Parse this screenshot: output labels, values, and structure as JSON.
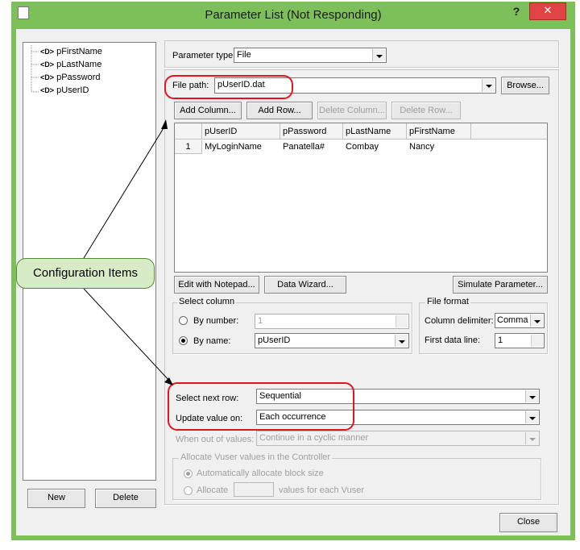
{
  "window": {
    "title": "Parameter List (Not Responding)",
    "help_glyph": "?",
    "close_glyph": "✕"
  },
  "tree": {
    "items": [
      "pFirstName",
      "pLastName",
      "pPassword",
      "pUserID"
    ],
    "icon_text": "<D>"
  },
  "left_buttons": {
    "new": "New",
    "delete": "Delete"
  },
  "param_type": {
    "label": "Parameter type:",
    "value": "File"
  },
  "file_path": {
    "label": "File path:",
    "value": "pUserID.dat",
    "browse": "Browse..."
  },
  "table_buttons": {
    "add_column": "Add Column...",
    "add_row": "Add Row...",
    "delete_column": "Delete Column...",
    "delete_row": "Delete Row..."
  },
  "table": {
    "headers": [
      "pUserID",
      "pPassword",
      "pLastName",
      "pFirstName"
    ],
    "rows": [
      {
        "num": "1",
        "cells": [
          "MyLoginName",
          "Panatella#",
          "Combay",
          "Nancy"
        ]
      }
    ]
  },
  "actions": {
    "edit_notepad": "Edit with Notepad...",
    "data_wizard": "Data Wizard...",
    "simulate": "Simulate Parameter..."
  },
  "select_column": {
    "title": "Select column",
    "by_number_label": "By number:",
    "by_number_value": "1",
    "by_name_label": "By name:",
    "by_name_value": "pUserID"
  },
  "file_format": {
    "title": "File format",
    "delimiter_label": "Column delimiter:",
    "delimiter_value": "Comma",
    "first_line_label": "First data line:",
    "first_line_value": "1"
  },
  "row_options": {
    "next_row_label": "Select next row:",
    "next_row_value": "Sequential",
    "update_label": "Update value on:",
    "update_value": "Each occurrence",
    "out_label": "When out of values:",
    "out_value": "Continue in a cyclic manner"
  },
  "allocate": {
    "title": "Allocate Vuser values in the Controller",
    "auto": "Automatically allocate block size",
    "manual": "Allocate",
    "suffix": "values for each Vuser"
  },
  "close_label": "Close",
  "callout": "Configuration Items",
  "colors": {
    "window_frame": "#7dc05a",
    "close_button": "#e04343",
    "annotation": "#e3141e",
    "callout_fill": "#d8ebc7"
  }
}
